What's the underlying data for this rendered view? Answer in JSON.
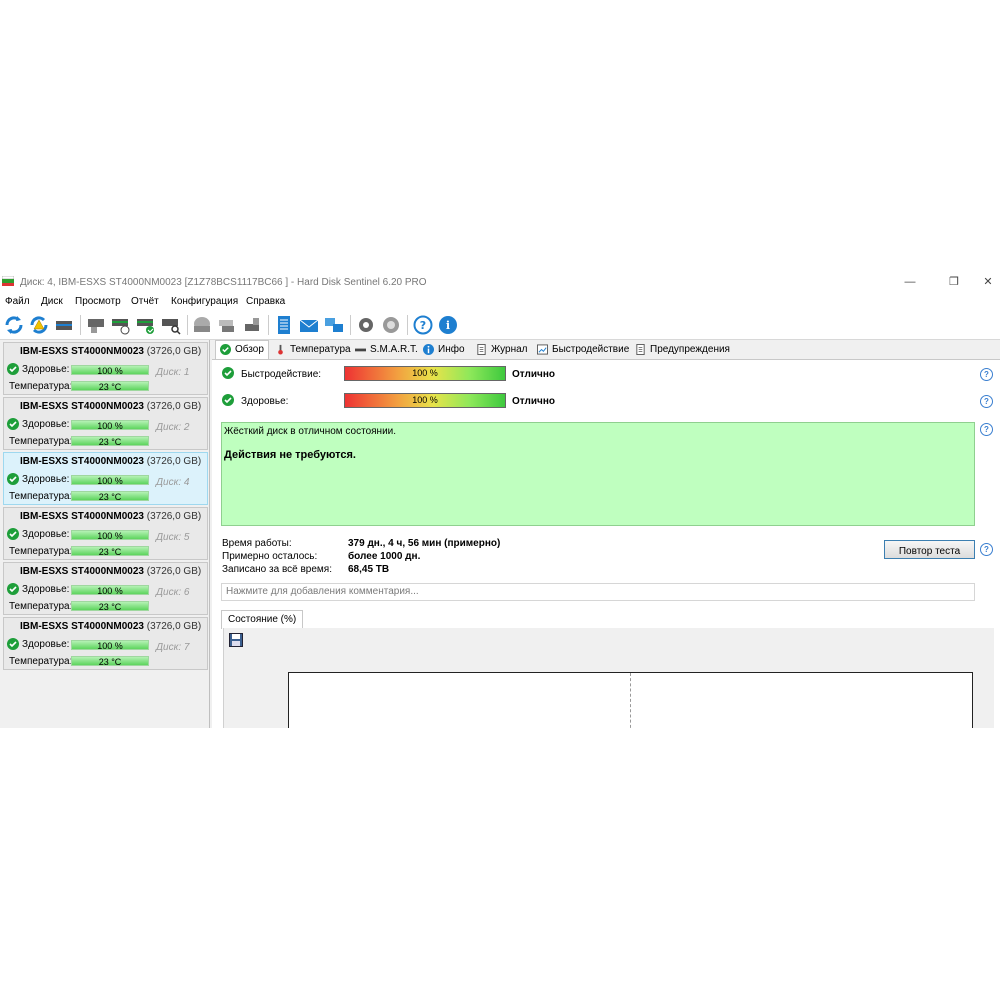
{
  "window": {
    "title": "Диск: 4, IBM-ESXS ST4000NM0023 [Z1Z78BCS1117BC66   ]  -  Hard Disk Sentinel 6.20 PRO",
    "controls": {
      "minimize": "—",
      "maximize": "❐",
      "close": "✕"
    }
  },
  "menu": [
    "Файл",
    "Диск",
    "Просмотр",
    "Отчёт",
    "Конфигурация",
    "Справка"
  ],
  "toolbar": {
    "icons": [
      "refresh-icon",
      "refresh-warning-icon",
      "disk-icon",
      "disk-gray-icon",
      "disk-clock-icon",
      "disk-check-icon",
      "disk-search-icon",
      "drive-icon",
      "drives-icon",
      "drive-alt-icon",
      "report-icon",
      "mail-icon",
      "network-icon",
      "settings-icon",
      "sound-icon",
      "help-icon",
      "info-icon"
    ]
  },
  "disks": [
    {
      "name": "IBM-ESXS ST4000NM0023",
      "size": "(3726,0 GB)",
      "number": "Диск: 1",
      "health_label": "Здоровье:",
      "health": "100 %",
      "health_fraction": 1.0,
      "temp_label": "Температура:",
      "temp": "23 °C"
    },
    {
      "name": "IBM-ESXS ST4000NM0023",
      "size": "(3726,0 GB)",
      "number": "Диск: 2",
      "health_label": "Здоровье:",
      "health": "100 %",
      "health_fraction": 1.0,
      "temp_label": "Температура:",
      "temp": "23 °C"
    },
    {
      "name": "IBM-ESXS ST4000NM0023",
      "size": "(3726,0 GB)",
      "number": "Диск: 4",
      "health_label": "Здоровье:",
      "health": "100 %",
      "health_fraction": 1.0,
      "temp_label": "Температура:",
      "temp": "23 °C",
      "selected": true
    },
    {
      "name": "IBM-ESXS ST4000NM0023",
      "size": "(3726,0 GB)",
      "number": "Диск: 5",
      "health_label": "Здоровье:",
      "health": "100 %",
      "health_fraction": 1.0,
      "temp_label": "Температура:",
      "temp": "23 °C"
    },
    {
      "name": "IBM-ESXS ST4000NM0023",
      "size": "(3726,0 GB)",
      "number": "Диск: 6",
      "health_label": "Здоровье:",
      "health": "100 %",
      "health_fraction": 1.0,
      "temp_label": "Температура:",
      "temp": "23 °C"
    },
    {
      "name": "IBM-ESXS ST4000NM0023",
      "size": "(3726,0 GB)",
      "number": "Диск: 7",
      "health_label": "Здоровье:",
      "health": "100 %",
      "health_fraction": 1.0,
      "temp_label": "Температура:",
      "temp": "23 °C"
    }
  ],
  "tabs": [
    "Обзор",
    "Температура",
    "S.M.A.R.T.",
    "Инфо",
    "Журнал",
    "Быстродействие",
    "Предупреждения"
  ],
  "overview": {
    "performance_label": "Быстродействие:",
    "performance_value": "100 %",
    "performance_rating": "Отлично",
    "health_label": "Здоровье:",
    "health_value": "100 %",
    "health_rating": "Отлично",
    "status_line1": "Жёсткий диск в отличном состоянии.",
    "status_line2": "Действия не требуются.",
    "uptime_label": "Время работы:",
    "uptime_value": "379 дн., 4 ч, 56 мин (примерно)",
    "remaining_label": "Примерно осталось:",
    "remaining_value": "более 1000 дн.",
    "written_label": "Записано за всё время:",
    "written_value": "68,45 TB",
    "retest_button": "Повтор теста",
    "comment_placeholder": "Нажмите для добавления комментария...",
    "subtab": "Состояние (%)",
    "help": "?"
  },
  "colors": {
    "status_green": "#bfffbf",
    "accent_blue": "#3a7fd0",
    "check_green": "#1e9e3a"
  }
}
